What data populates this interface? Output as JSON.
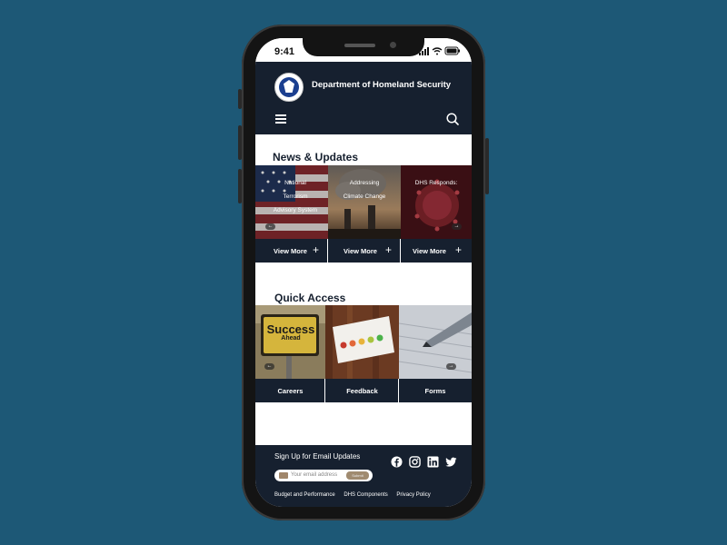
{
  "status_bar": {
    "time": "9:41"
  },
  "header": {
    "agency_name": "Department of Homeland Security",
    "menu_icon": "hamburger-icon",
    "search_icon": "search-icon"
  },
  "news": {
    "title": "News & Updates",
    "cards": [
      {
        "caption": [
          "National",
          "Terrorism",
          "Advisory System"
        ],
        "cta": "View More"
      },
      {
        "caption": [
          "Addressing",
          "Climate Change"
        ],
        "cta": "View More"
      },
      {
        "caption": [
          "DHS Responds:"
        ],
        "cta": "View More"
      }
    ]
  },
  "quick_access": {
    "title": "Quick Access",
    "cards": [
      {
        "label": "Careers",
        "sign_top": "Success",
        "sign_bottom": "Ahead"
      },
      {
        "label": "Feedback"
      },
      {
        "label": "Forms"
      }
    ]
  },
  "footer": {
    "signup_label": "Sign Up for Email Updates",
    "email_placeholder": "Your email address",
    "submit_label": "Submit",
    "social": [
      "facebook-icon",
      "instagram-icon",
      "linkedin-icon",
      "twitter-icon"
    ],
    "links": [
      "Budget and Performance",
      "DHS Components",
      "Privacy Policy"
    ]
  },
  "colors": {
    "background": "#1d5876",
    "navy": "#16202f",
    "accent": "#a08b70"
  }
}
